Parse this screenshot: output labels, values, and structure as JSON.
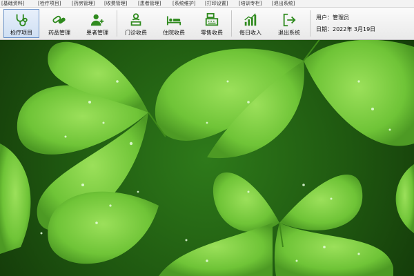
{
  "menubar": {
    "items": [
      {
        "label": "[基础资料]"
      },
      {
        "label": "[检疗项目]"
      },
      {
        "label": "[药房管理]"
      },
      {
        "label": "[收费管理]"
      },
      {
        "label": "[患者管理]"
      },
      {
        "label": "[系统维护]"
      },
      {
        "label": "[打印设置]"
      },
      {
        "label": "[培训专栏]"
      },
      {
        "label": "[退出系统]"
      }
    ]
  },
  "toolbar": {
    "buttons": [
      {
        "label": "检疗项目",
        "icon": "stethoscope-icon"
      },
      {
        "label": "药品管理",
        "icon": "pills-icon"
      },
      {
        "label": "患者管理",
        "icon": "patient-icon"
      },
      {
        "label": "门诊收费",
        "icon": "outpatient-icon"
      },
      {
        "label": "住院收费",
        "icon": "hospital-bed-icon"
      },
      {
        "label": "零售收费",
        "icon": "cash-register-icon"
      },
      {
        "label": "每日收入",
        "icon": "bar-chart-icon"
      },
      {
        "label": "退出系统",
        "icon": "exit-icon"
      }
    ],
    "active_index": 0
  },
  "userinfo": {
    "user_line": "用户：管理员",
    "date_line": "日期：2022年 3月19日"
  },
  "colors": {
    "icon_green": "#2f8a1e",
    "active_border": "#6b93c9",
    "leaf": "#7ed341"
  }
}
